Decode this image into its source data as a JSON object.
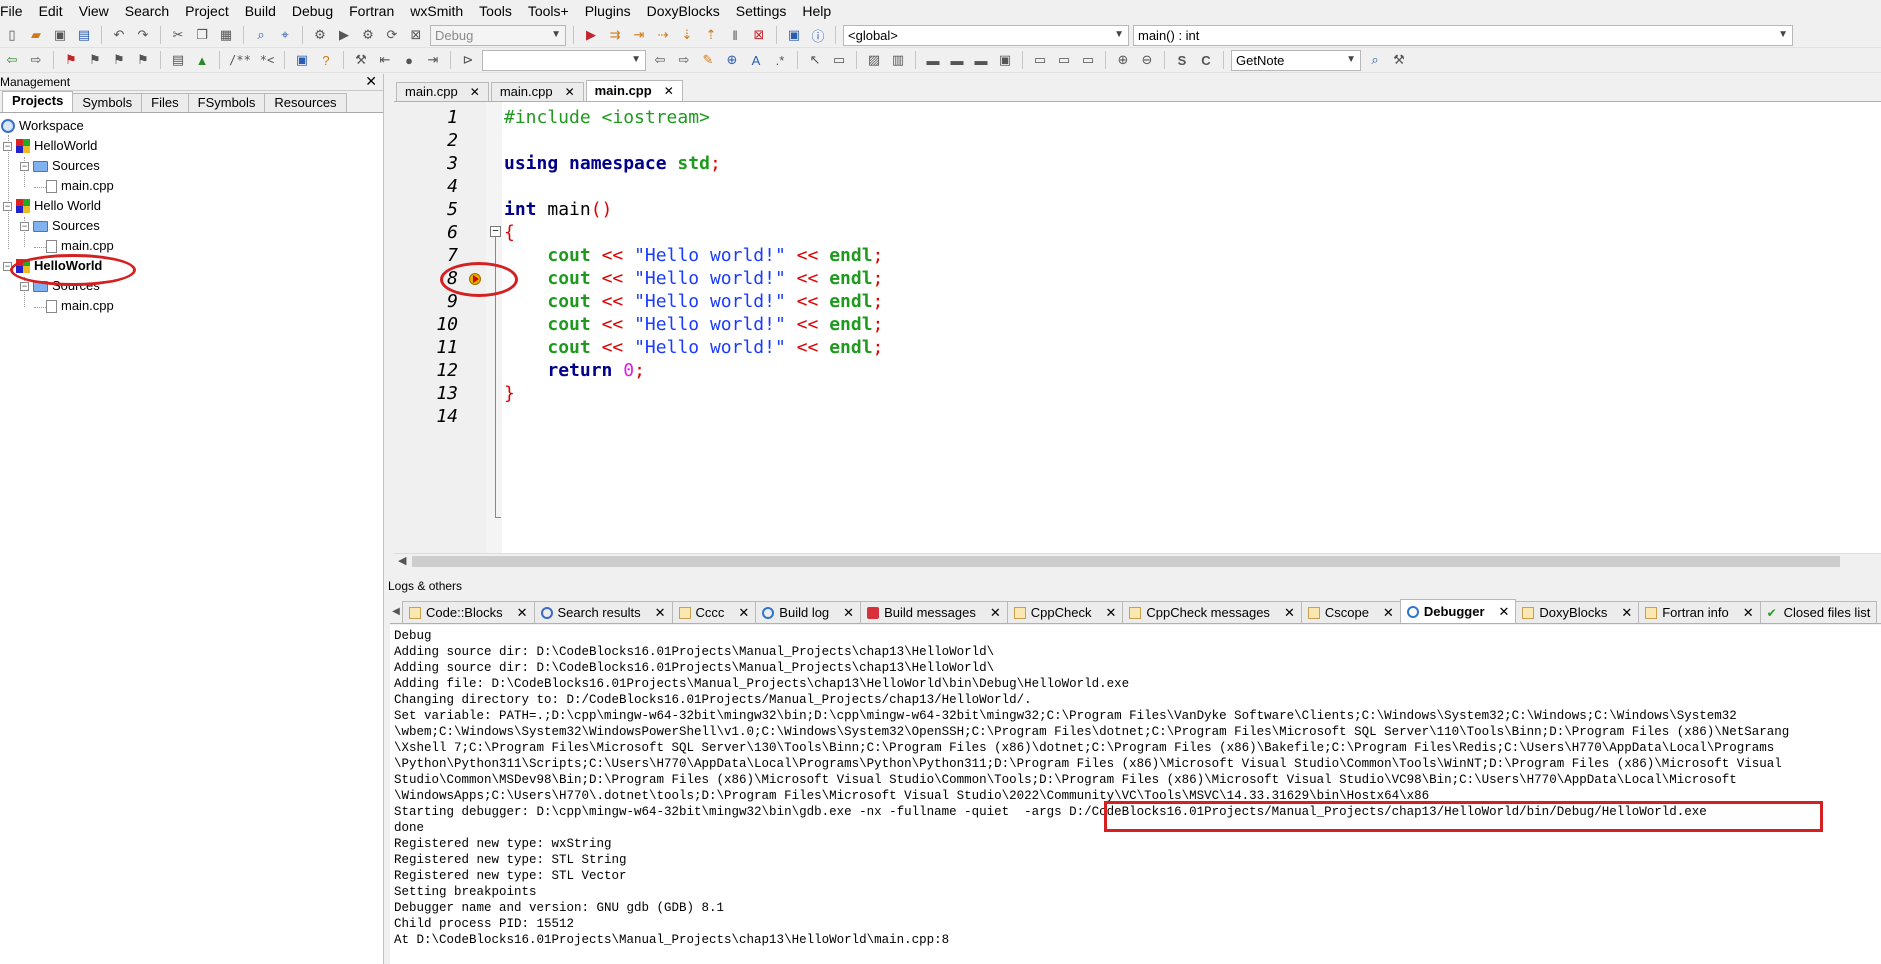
{
  "menu": [
    "File",
    "Edit",
    "View",
    "Search",
    "Project",
    "Build",
    "Debug",
    "Fortran",
    "wxSmith",
    "Tools",
    "Tools+",
    "Plugins",
    "DoxyBlocks",
    "Settings",
    "Help"
  ],
  "toolbar": {
    "build_target": "Debug",
    "scope_select": "<global>",
    "function_select": "main() : int",
    "search_combo": "",
    "plugin_select": "GetNote",
    "comment_block_label": "/**",
    "comment_line_label": "*<"
  },
  "management": {
    "title": "Management",
    "tabs": [
      "Projects",
      "Symbols",
      "Files",
      "FSymbols",
      "Resources"
    ],
    "tree": {
      "workspace": "Workspace",
      "projects": [
        {
          "name": "HelloWorld",
          "folder": "Sources",
          "file": "main.cpp"
        },
        {
          "name": "Hello World",
          "folder": "Sources",
          "file": "main.cpp"
        },
        {
          "name": "HelloWorld",
          "folder": "Sources",
          "file": "main.cpp"
        }
      ]
    }
  },
  "editor": {
    "tabs": [
      "main.cpp",
      "main.cpp",
      "main.cpp"
    ],
    "line_numbers": [
      "1",
      "2",
      "3",
      "4",
      "5",
      "6",
      "7",
      "8",
      "9",
      "10",
      "11",
      "12",
      "13",
      "14"
    ],
    "lines": {
      "l1": "#include <iostream>",
      "l3_kw": "using",
      "l3_ns": "namespace",
      "l3_std": "std",
      "l5_type": "int",
      "l5_name": " main",
      "l6": "{",
      "cout": "cout",
      "shl": "<<",
      "hello": "\"Hello world!\"",
      "endl": "endl",
      "semi": ";",
      "l12_kw": "return",
      "l12_num": "0",
      "l13": "}"
    }
  },
  "logs": {
    "title": "Logs & others",
    "tabs": [
      "Code::Blocks",
      "Search results",
      "Cccc",
      "Build log",
      "Build messages",
      "CppCheck",
      "CppCheck messages",
      "Cscope",
      "Debugger",
      "DoxyBlocks",
      "Fortran info",
      "Closed files list"
    ],
    "active_tab": "Debugger",
    "output": [
      "Debug",
      "Adding source dir: D:\\CodeBlocks16.01Projects\\Manual_Projects\\chap13\\HelloWorld\\",
      "Adding source dir: D:\\CodeBlocks16.01Projects\\Manual_Projects\\chap13\\HelloWorld\\",
      "Adding file: D:\\CodeBlocks16.01Projects\\Manual_Projects\\chap13\\HelloWorld\\bin\\Debug\\HelloWorld.exe",
      "Changing directory to: D:/CodeBlocks16.01Projects/Manual_Projects/chap13/HelloWorld/.",
      "Set variable: PATH=.;D:\\cpp\\mingw-w64-32bit\\mingw32\\bin;D:\\cpp\\mingw-w64-32bit\\mingw32;C:\\Program Files\\VanDyke Software\\Clients;C:\\Windows\\System32;C:\\Windows;C:\\Windows\\System32",
      "\\wbem;C:\\Windows\\System32\\WindowsPowerShell\\v1.0;C:\\Windows\\System32\\OpenSSH;C:\\Program Files\\dotnet;C:\\Program Files\\Microsoft SQL Server\\110\\Tools\\Binn;D:\\Program Files (x86)\\NetSarang",
      "\\Xshell 7;C:\\Program Files\\Microsoft SQL Server\\130\\Tools\\Binn;C:\\Program Files (x86)\\dotnet;C:\\Program Files (x86)\\Bakefile;C:\\Program Files\\Redis;C:\\Users\\H770\\AppData\\Local\\Programs",
      "\\Python\\Python311\\Scripts;C:\\Users\\H770\\AppData\\Local\\Programs\\Python\\Python311;D:\\Program Files (x86)\\Microsoft Visual Studio\\Common\\Tools\\WinNT;D:\\Program Files (x86)\\Microsoft Visual",
      "Studio\\Common\\MSDev98\\Bin;D:\\Program Files (x86)\\Microsoft Visual Studio\\Common\\Tools;D:\\Program Files (x86)\\Microsoft Visual Studio\\VC98\\Bin;C:\\Users\\H770\\AppData\\Local\\Microsoft",
      "\\WindowsApps;C:\\Users\\H770\\.dotnet\\tools;D:\\Program Files\\Microsoft Visual Studio\\2022\\Community\\VC\\Tools\\MSVC\\14.33.31629\\bin\\Hostx64\\x86",
      "Starting debugger: D:\\cpp\\mingw-w64-32bit\\mingw32\\bin\\gdb.exe -nx -fullname -quiet  -args D:/CodeBlocks16.01Projects/Manual_Projects/chap13/HelloWorld/bin/Debug/HelloWorld.exe",
      "done",
      "Registered new type: wxString",
      "Registered new type: STL String",
      "Registered new type: STL Vector",
      "Setting breakpoints",
      "Debugger name and version: GNU gdb (GDB) 8.1",
      "Child process PID: 15512",
      "At D:\\CodeBlocks16.01Projects\\Manual_Projects\\chap13\\HelloWorld\\main.cpp:8"
    ]
  },
  "colors": {
    "annotation": "#d42020",
    "keyword": "#00008b",
    "string": "#1a3bff",
    "operator": "#dd0000",
    "preprocessor": "#1f9a1f"
  }
}
